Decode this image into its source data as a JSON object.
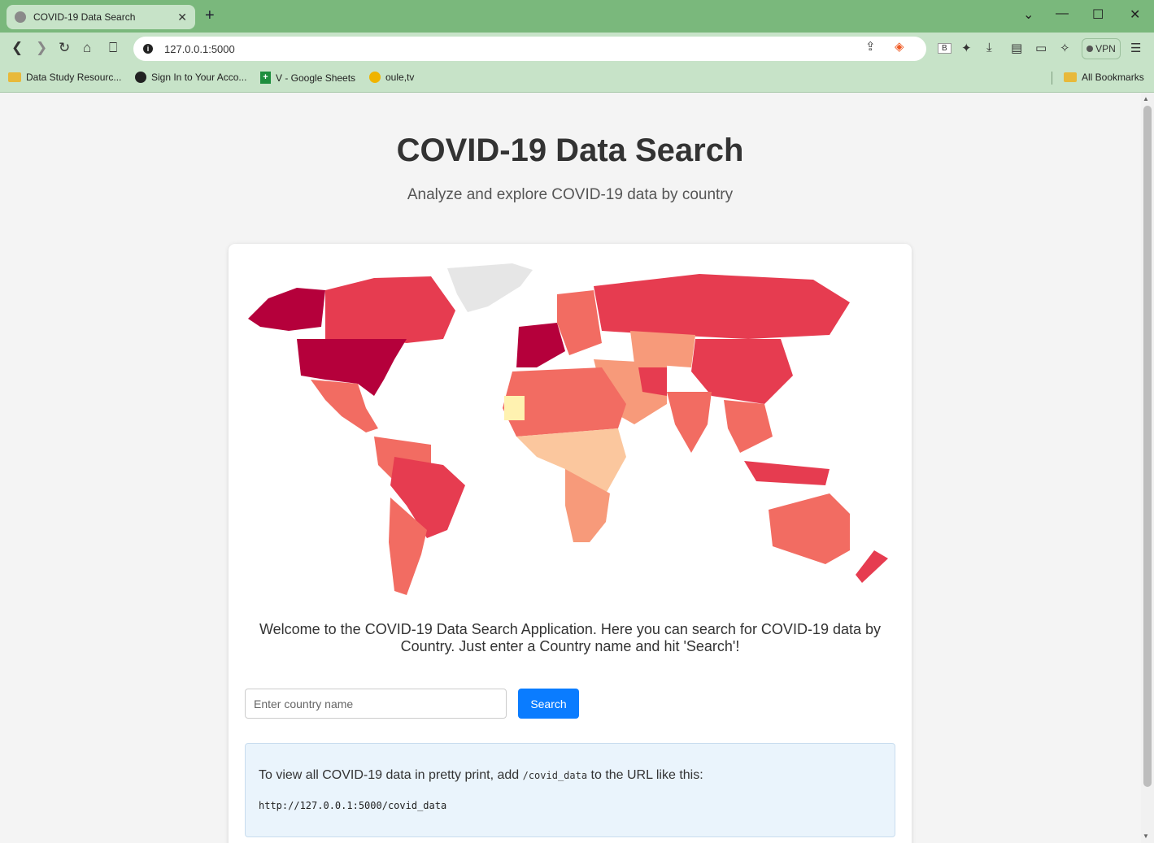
{
  "browser": {
    "tab_title": "COVID-19 Data Search",
    "tab_close": "✕",
    "new_tab": "+",
    "url": "127.0.0.1:5000",
    "vpn_label": "VPN",
    "bookmarks": [
      {
        "label": "Data Study Resourc...",
        "icon": "folder-icon"
      },
      {
        "label": "Sign In to Your Acco...",
        "icon": "globe-icon"
      },
      {
        "label": "V - Google Sheets",
        "icon": "google-sheets-icon"
      },
      {
        "label": "oule,tv",
        "icon": "oule-icon"
      }
    ],
    "all_bookmarks": "All Bookmarks"
  },
  "page": {
    "title": "COVID-19 Data Search",
    "subtitle": "Analyze and explore COVID-19 data by country",
    "welcome": "Welcome to the COVID-19 Data Search Application. Here you can search for COVID-19 data by Country. Just enter a Country name and hit 'Search'!",
    "search_placeholder": "Enter country name",
    "search_button": "Search",
    "info_text_before": "To view all COVID-19 data in pretty print, add ",
    "info_code": "/covid_data",
    "info_text_after": " to the URL like this:",
    "info_url": "http://127.0.0.1:5000/covid_data"
  },
  "map": {
    "type": "choropleth world map",
    "colors": {
      "highest": "#b5003b",
      "high": "#e63c50",
      "medium_high": "#f26c62",
      "medium": "#f79a7a",
      "low": "#fbc79e",
      "lowest": "#fff2b0",
      "no_data": "#e6e6e6"
    }
  }
}
